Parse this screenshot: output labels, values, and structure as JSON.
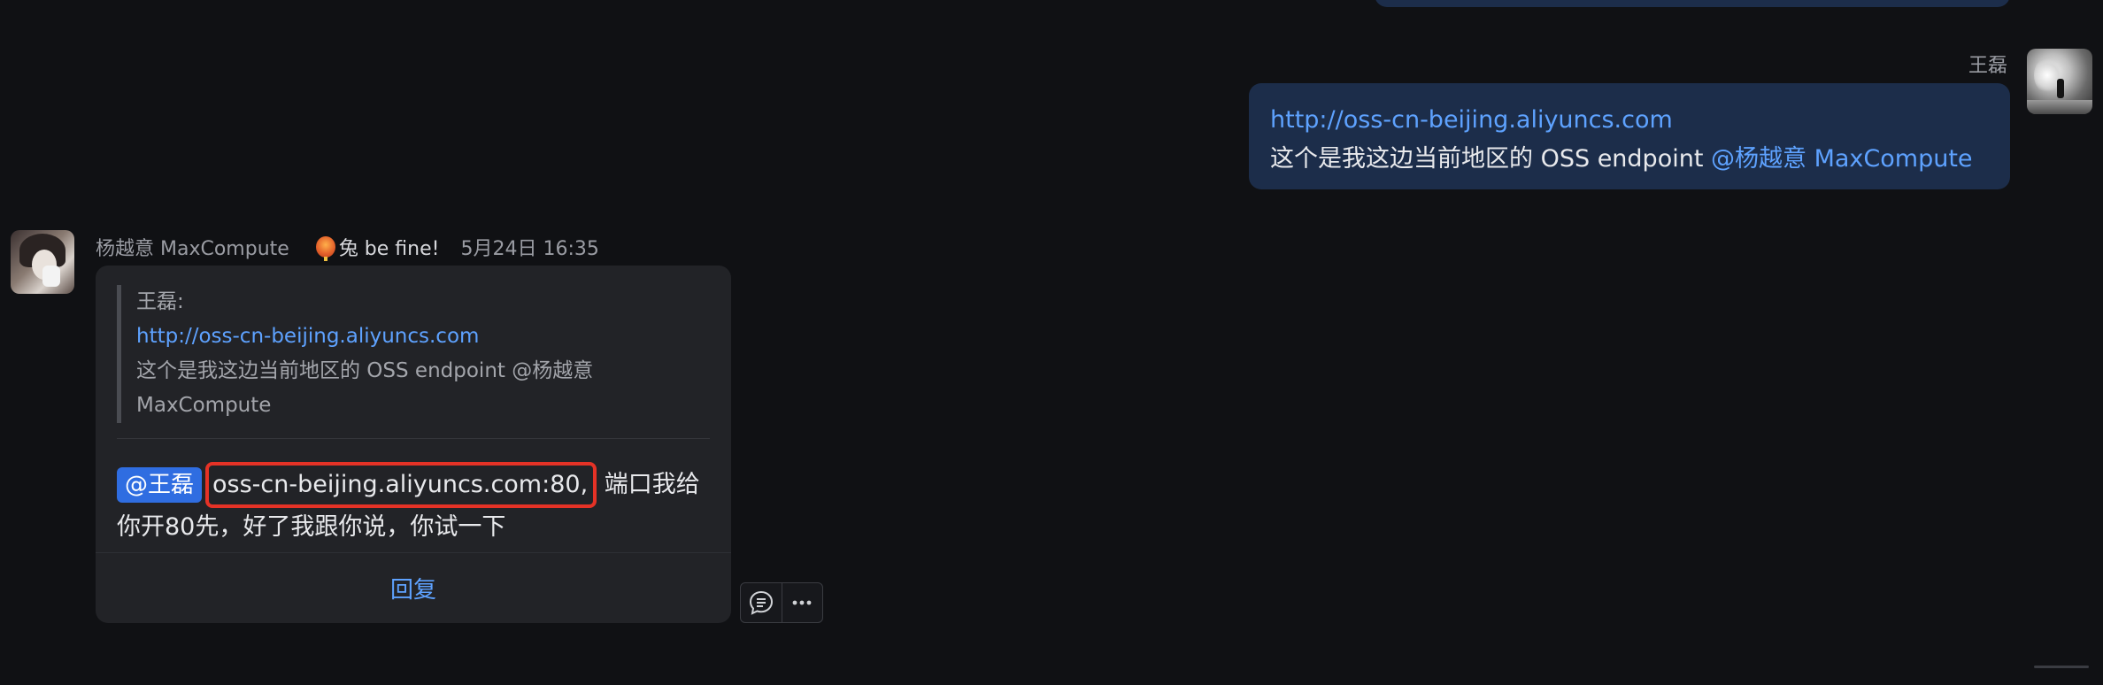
{
  "outgoing": {
    "sender_name": "王磊",
    "link": "http://oss-cn-beijing.aliyuncs.com",
    "text_prefix": "这个是我这边当前地区的 OSS endpoint ",
    "mention": "@杨越意 MaxCompute"
  },
  "incoming": {
    "sender_name": "杨越意 MaxCompute",
    "status_text": "兔 be fine!",
    "timestamp": "5月24日 16:35",
    "quote": {
      "author": "王磊:",
      "link": "http://oss-cn-beijing.aliyuncs.com",
      "text_line1": "这个是我这边当前地区的 OSS endpoint @杨越意",
      "text_line2": "MaxCompute"
    },
    "mention_tag": "@王磊",
    "highlighted_text": "oss-cn-beijing.aliyuncs.com:80,",
    "body_rest": " 端口我给你开80先，好了我跟你说，你试一下",
    "reply_label": "回复"
  },
  "colors": {
    "background": "#101114",
    "outgoing_bubble": "#1c2d4a",
    "incoming_card": "#222327",
    "link": "#5ea2ff",
    "mention_tag": "#2f6de1",
    "highlight_border": "#e53226"
  },
  "icons": {
    "reply_thread": "chat-bubble-icon",
    "more": "more-dots-icon"
  }
}
